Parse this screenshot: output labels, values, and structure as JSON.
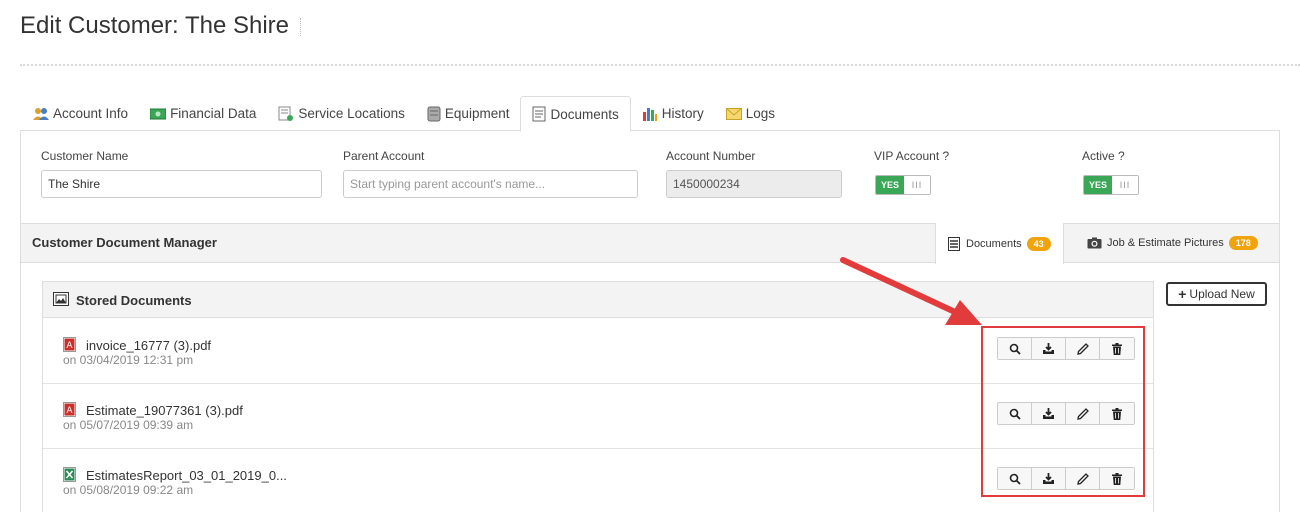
{
  "page": {
    "title": "Edit Customer: The Shire"
  },
  "tabs": [
    {
      "label": "Account Info",
      "icon": "users-icon"
    },
    {
      "label": "Financial Data",
      "icon": "money-icon"
    },
    {
      "label": "Service Locations",
      "icon": "location-icon"
    },
    {
      "label": "Equipment",
      "icon": "equipment-icon"
    },
    {
      "label": "Documents",
      "icon": "document-icon",
      "active": true
    },
    {
      "label": "History",
      "icon": "chart-icon"
    },
    {
      "label": "Logs",
      "icon": "envelope-icon"
    }
  ],
  "form": {
    "customer_name": {
      "label": "Customer Name",
      "value": "The Shire"
    },
    "parent_account": {
      "label": "Parent Account",
      "value": "",
      "placeholder": "Start typing parent account's name..."
    },
    "account_number": {
      "label": "Account Number",
      "value": "1450000234"
    },
    "vip_account": {
      "label": "VIP Account ?",
      "yes": "YES",
      "grip": "III"
    },
    "active": {
      "label": "Active ?",
      "yes": "YES",
      "grip": "III"
    }
  },
  "doc_manager": {
    "title": "Customer Document Manager",
    "tabs": [
      {
        "label": "Documents",
        "count": "43"
      },
      {
        "label": "Job & Estimate Pictures",
        "count": "178"
      }
    ]
  },
  "stored_documents": {
    "title": "Stored Documents",
    "upload_label": "Upload New",
    "items": [
      {
        "name": "invoice_16777 (3).pdf",
        "date": "on 03/04/2019 12:31 pm",
        "type": "pdf"
      },
      {
        "name": "Estimate_19077361 (3).pdf",
        "date": "on 05/07/2019 09:39 am",
        "type": "pdf"
      },
      {
        "name": "EstimatesReport_03_01_2019_0...",
        "date": "on 05/08/2019 09:22 am",
        "type": "excel"
      }
    ]
  },
  "colors": {
    "accent_green": "#3aa757",
    "badge_orange": "#f0a30a",
    "annotation_red": "#e23b3b"
  }
}
